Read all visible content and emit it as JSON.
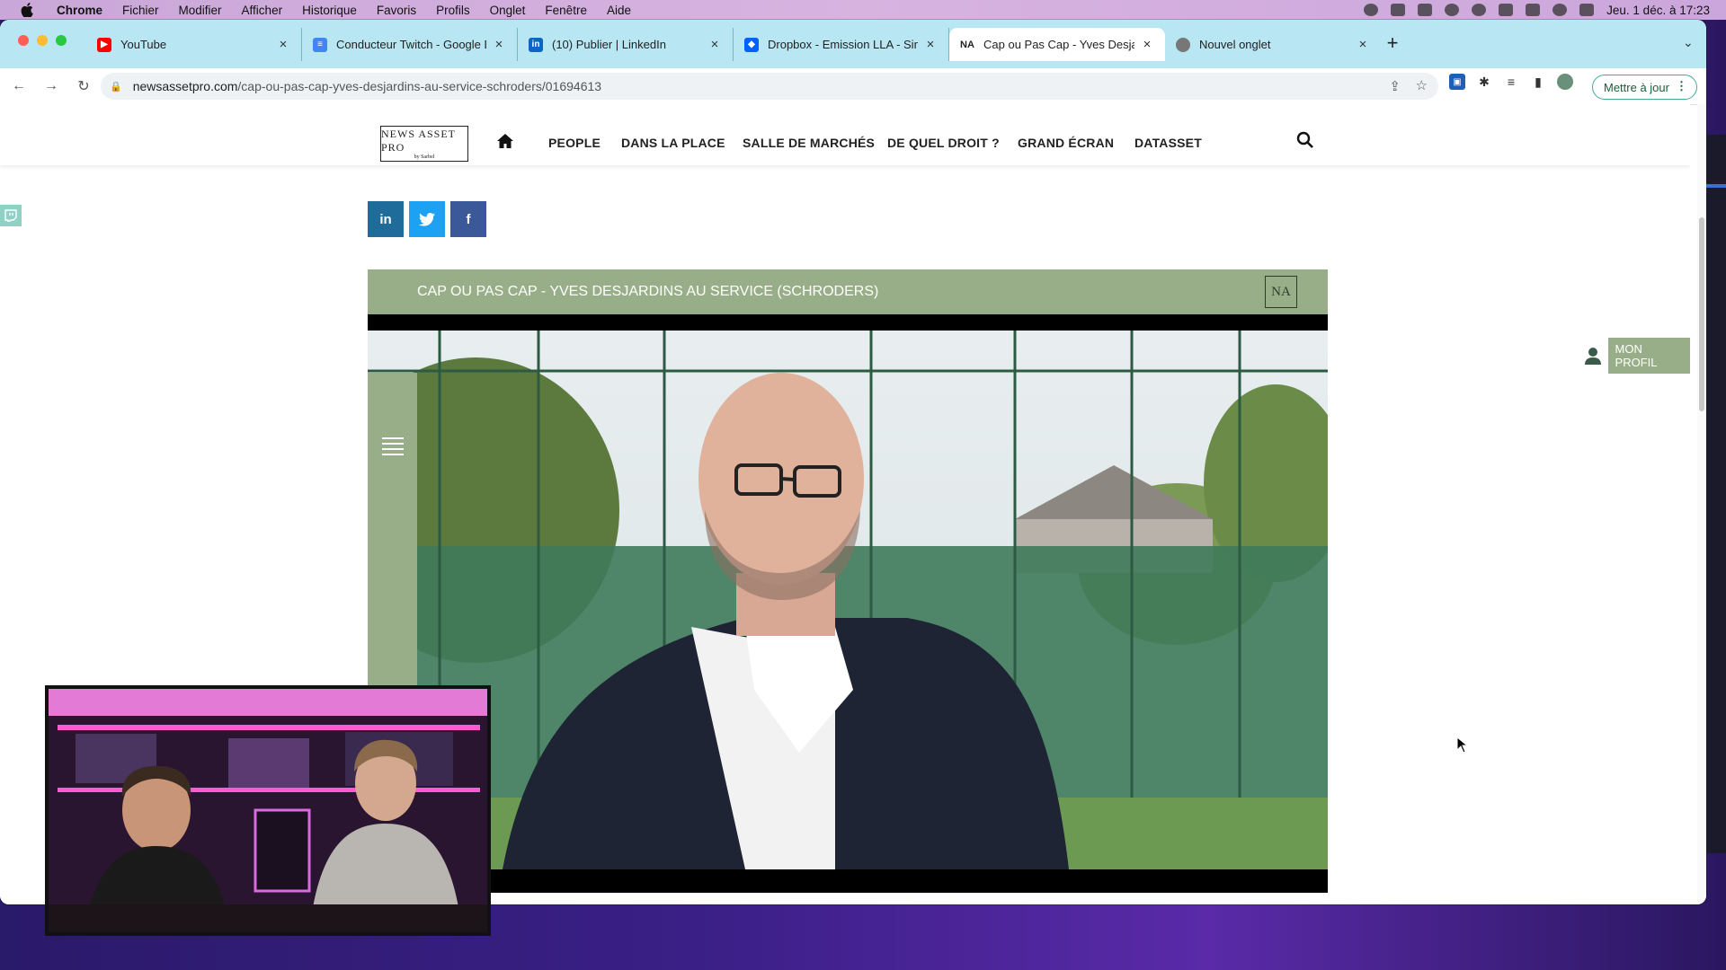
{
  "menubar": {
    "app": "Chrome",
    "items": [
      "Fichier",
      "Modifier",
      "Afficher",
      "Historique",
      "Favoris",
      "Profils",
      "Onglet",
      "Fenêtre",
      "Aide"
    ],
    "datetime": "Jeu. 1 déc. à 17:23"
  },
  "tabs": [
    {
      "title": "YouTube",
      "icon": "youtube-icon",
      "color": "#ff0000"
    },
    {
      "title": "Conducteur Twitch - Google D",
      "icon": "google-docs-icon",
      "color": "#4285f4"
    },
    {
      "title": "(10) Publier | LinkedIn",
      "icon": "linkedin-icon",
      "color": "#0a66c2"
    },
    {
      "title": "Dropbox - Emission LLA - Simp",
      "icon": "dropbox-icon",
      "color": "#0061fe"
    },
    {
      "title": "Cap ou Pas Cap - Yves Desjard",
      "icon": "newsassetpro-icon",
      "color": "#222222",
      "active": true
    },
    {
      "title": "Nouvel onglet",
      "icon": "chrome-icon",
      "color": "#555555"
    }
  ],
  "address": {
    "domain": "newsassetpro.com",
    "path": "/cap-ou-pas-cap-yves-desjardins-au-service-schroders/01694613"
  },
  "update_button": "Mettre à jour",
  "site": {
    "logo_text": "NEWS ASSET PRO",
    "logo_sub": "by Sarbel",
    "nav": [
      "PEOPLE",
      "DANS LA PLACE",
      "SALLE DE MARCHÉS",
      "DE QUEL DROIT ?",
      "GRAND ÉCRAN",
      "DATASSET"
    ],
    "share": [
      {
        "label": "in",
        "color": "#1f6b9a"
      },
      {
        "label": "t",
        "color": "#1da1f2"
      },
      {
        "label": "f",
        "color": "#3b5998"
      }
    ],
    "video_title": "CAP OU PAS CAP - YVES DESJARDINS AU SERVICE (SCHRODERS)",
    "video_logo": "NA",
    "profile_label": "MON PROFIL",
    "accent": "#98ae88"
  }
}
